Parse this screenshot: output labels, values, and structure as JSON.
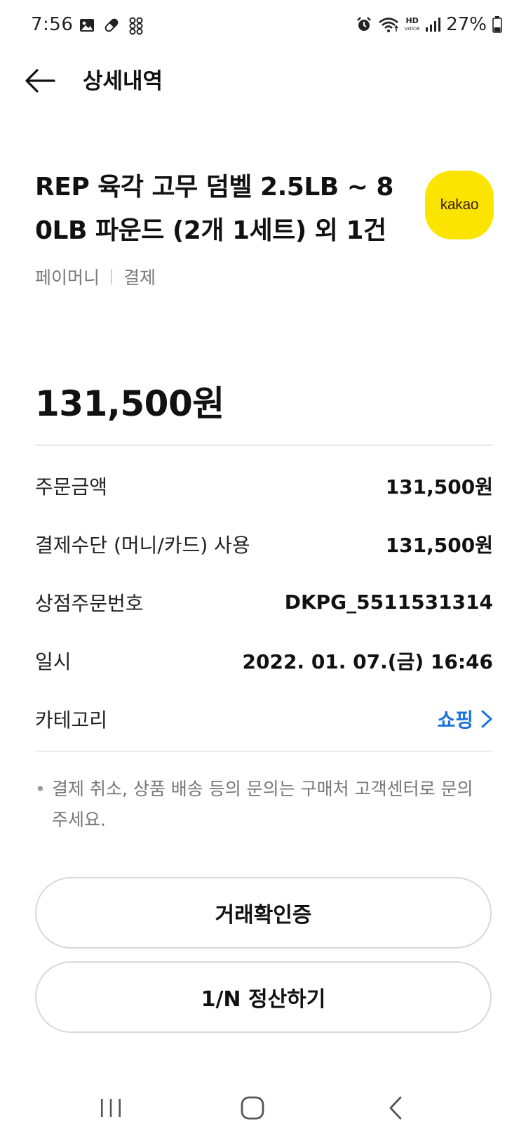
{
  "status_bar": {
    "time": "7:56",
    "battery": "27%",
    "network_badge_top": "HD",
    "network_badge_bottom": "voice"
  },
  "header": {
    "title": "상세내역"
  },
  "product": {
    "title_line1": "REP 육각 고무 덤벨 2.5LB ~ 8",
    "title_line2": "0LB 파운드 (2개 1세트) 외 1건",
    "logo_text": "kakao",
    "payment_source": "페이머니",
    "payment_type": "결제"
  },
  "total_amount": "131,500원",
  "details": {
    "order_amount_label": "주문금액",
    "order_amount_value": "131,500원",
    "payment_method_label": "결제수단 (머니/카드) 사용",
    "payment_method_value": "131,500원",
    "store_order_label": "상점주문번호",
    "store_order_value": "DKPG_5511531314",
    "datetime_label": "일시",
    "datetime_value": "2022. 01. 07.(금) 16:46",
    "category_label": "카테고리",
    "category_value": "쇼핑"
  },
  "notice": {
    "bullet": "•",
    "text": "결제 취소, 상품 배송 등의 문의는 구매처 고객센터로 문의 주세요."
  },
  "buttons": {
    "verify_label": "거래확인증",
    "split_label": "1/N 정산하기"
  },
  "colors": {
    "kakao_yellow": "#fbe500",
    "link_blue": "#1a73d9"
  },
  "icons": {
    "back": "arrow-left-icon",
    "category_chevron": "chevron-right-icon",
    "nav_recent": "recent-apps-icon",
    "nav_home": "home-icon",
    "nav_back": "nav-back-icon"
  }
}
